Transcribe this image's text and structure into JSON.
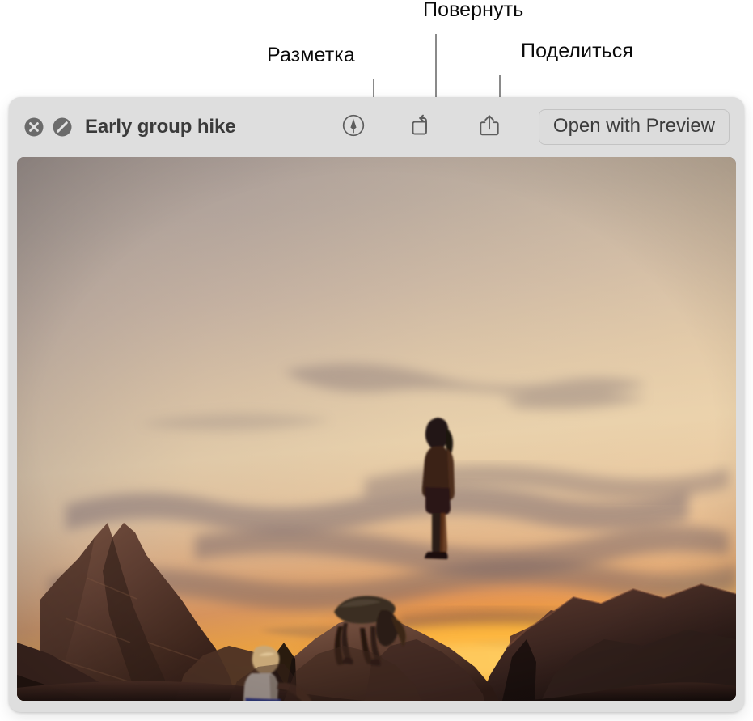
{
  "callouts": [
    {
      "id": "markup",
      "label": "Разметка",
      "points_to": "markup-button"
    },
    {
      "id": "rotate",
      "label": "Повернуть",
      "points_to": "rotate-button"
    },
    {
      "id": "share",
      "label": "Поделиться",
      "points_to": "share-button"
    }
  ],
  "window": {
    "title": "Early group hike",
    "titlebar": {
      "close_icon": "close-circle-icon",
      "annotate_disabled_icon": "slash-circle-icon",
      "tools": [
        {
          "name": "markup-button",
          "icon": "markup-pen-circle-icon"
        },
        {
          "name": "rotate-button",
          "icon": "rotate-right-icon"
        },
        {
          "name": "share-button",
          "icon": "share-up-arrow-icon"
        }
      ],
      "open_with_label": "Open with Preview"
    },
    "photo": {
      "description": "Three hikers silhouetted on red sandstone rocks at sunset",
      "alt_subjects": [
        "seated hiker",
        "bending hiker",
        "standing hiker"
      ]
    }
  },
  "colors": {
    "window_chrome": "#dedede",
    "title_text": "#3b3b3b",
    "button_border": "#c3c3c3",
    "icon_gray": "#6b6b6b",
    "leader_line": "#8a8a8a",
    "callout_text": "#0a0a0a",
    "sky_top_left": "#a69a96",
    "sky_warm_center": "#e8d3b2",
    "sunset_glow": "#f79420",
    "sunset_core": "#ffb43c",
    "cloud_dark": "#8e8189",
    "rock_light": "#6f4c3e",
    "rock_dark": "#2d1c18",
    "rock_shadow": "#1c1210"
  }
}
